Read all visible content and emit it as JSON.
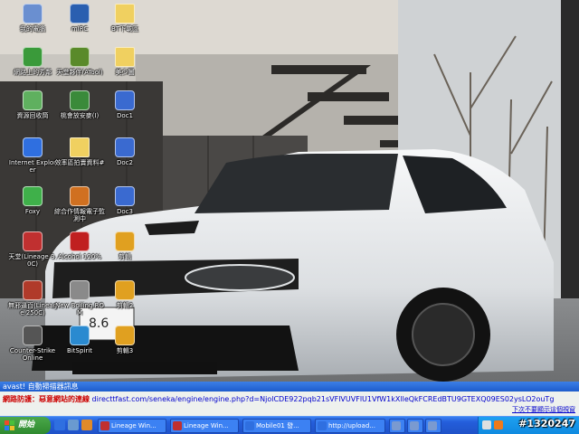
{
  "desktop_icons": [
    {
      "label": "我的電腦",
      "icon": "computer-icon",
      "color": "#6a8fd0"
    },
    {
      "label": "網路上的芳鄰",
      "icon": "network-icon",
      "color": "#3a9a3a"
    },
    {
      "label": "資源回收筒",
      "icon": "recycle-bin-icon",
      "color": "#5fb05f"
    },
    {
      "label": "Internet Explorer",
      "icon": "ie-icon",
      "color": "#2f6fe0"
    },
    {
      "label": "Foxy",
      "icon": "foxy-icon",
      "color": "#3fb04a"
    },
    {
      "label": "天堂(Lineage 3.0C)",
      "icon": "lineage-icon",
      "color": "#c03030"
    },
    {
      "label": "無邪逼百(Lineage 250C)",
      "icon": "lineage2-icon",
      "color": "#b03a2a"
    },
    {
      "label": "Counter-Strike Online",
      "icon": "cs-icon",
      "color": "#555555"
    },
    {
      "label": "mIRC",
      "icon": "mirc-icon",
      "color": "#2a5fb0"
    },
    {
      "label": "天堂夥伴(ATool)",
      "icon": "atool-icon",
      "color": "#5a8a2a"
    },
    {
      "label": "桃會放安麥(I)",
      "icon": "spreadsheet-icon",
      "color": "#3a8a3a"
    },
    {
      "label": "效率區拍賣資料#",
      "icon": "folder-icon",
      "color": "#f0d060"
    },
    {
      "label": "綜合作情報電子監測中",
      "icon": "monitor-app-icon",
      "color": "#d07020"
    },
    {
      "label": "Alcohol 120%",
      "icon": "alcohol-icon",
      "color": "#c02020"
    },
    {
      "label": "New Boiling ROM",
      "icon": "disc-icon",
      "color": "#8a8a8a"
    },
    {
      "label": "BitSpirit",
      "icon": "bitspirit-icon",
      "color": "#2a8ad0"
    },
    {
      "label": "BT下載區",
      "icon": "folder-icon",
      "color": "#f0d060"
    },
    {
      "label": "美少圖",
      "icon": "folder-icon",
      "color": "#f0d060"
    },
    {
      "label": "Doc1",
      "icon": "word-doc-icon",
      "color": "#3a6ad0"
    },
    {
      "label": "Doc2",
      "icon": "word-doc-icon",
      "color": "#3a6ad0"
    },
    {
      "label": "Doc3",
      "icon": "word-doc-icon",
      "color": "#3a6ad0"
    },
    {
      "label": "剪輯",
      "icon": "jpeg-icon",
      "color": "#e0a020"
    },
    {
      "label": "剪輯2",
      "icon": "jpeg-icon",
      "color": "#e0a020"
    },
    {
      "label": "剪輯3",
      "icon": "jpeg-icon",
      "color": "#e0a020"
    }
  ],
  "avast": {
    "title": "avast! 自動掃描器訊息",
    "prefix": "網路防護：惡意網站的連線",
    "url": "directtfast.com/seneka/engine/engine.php?d=NjolCDE922pqb21sVFlVUVFlU1VfW1kXlleQkFCREdBTU9GTEXQ09ES02ysLO2ouTg",
    "hide_link": "下次不要顯示這個視窗"
  },
  "taskbar": {
    "start_label": "開始",
    "tasks": [
      {
        "label": "Lineage Win...",
        "icon": "lineage-icon",
        "color": "#c03030"
      },
      {
        "label": "Lineage Win...",
        "icon": "lineage-icon",
        "color": "#c03030"
      },
      {
        "label": "Mobile01 發...",
        "icon": "ie-icon",
        "color": "#2f6fe0"
      },
      {
        "label": "http://upload...",
        "icon": "ie-icon",
        "color": "#2f6fe0"
      },
      {
        "label": "",
        "icon": "window-icon",
        "color": "#7a9ad0"
      },
      {
        "label": "",
        "icon": "window-icon",
        "color": "#7a9ad0"
      },
      {
        "label": "",
        "icon": "window-icon",
        "color": "#7a9ad0"
      }
    ]
  },
  "watermark": "#1320247",
  "colors": {
    "taskbar": "#245edb",
    "start": "#2f8a2f",
    "avast_title": "#1e5ccc"
  }
}
